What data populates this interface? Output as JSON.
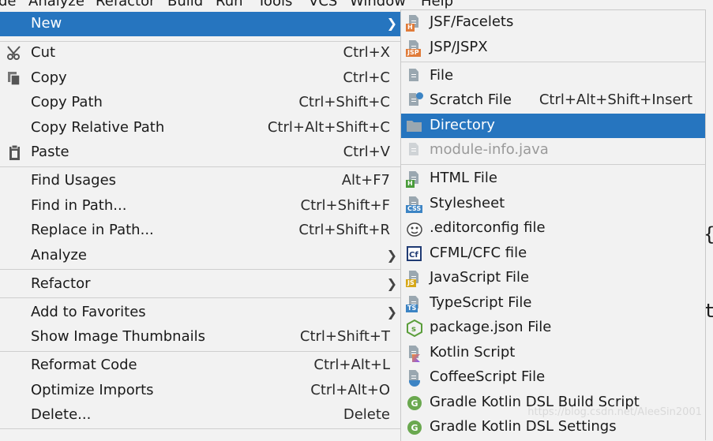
{
  "menubar": [
    "de",
    "Analyze",
    "Refactor",
    "Build",
    "Run",
    "Tools",
    "VCS",
    "Window",
    "Help"
  ],
  "editor": {
    "brace": "{",
    "t": "t"
  },
  "context_menu": {
    "items": [
      {
        "label": "New",
        "shortcut": "",
        "submenu": true,
        "selected": true
      },
      {
        "label": "Cut",
        "shortcut": "Ctrl+X",
        "icon": "scissors-icon"
      },
      {
        "label": "Copy",
        "shortcut": "Ctrl+C",
        "icon": "copy-icon"
      },
      {
        "label": "Copy Path",
        "shortcut": "Ctrl+Shift+C"
      },
      {
        "label": "Copy Relative Path",
        "shortcut": "Ctrl+Alt+Shift+C"
      },
      {
        "label": "Paste",
        "shortcut": "Ctrl+V",
        "icon": "paste-icon"
      },
      {
        "label": "Find Usages",
        "shortcut": "Alt+F7"
      },
      {
        "label": "Find in Path...",
        "shortcut": "Ctrl+Shift+F"
      },
      {
        "label": "Replace in Path...",
        "shortcut": "Ctrl+Shift+R"
      },
      {
        "label": "Analyze",
        "shortcut": "",
        "submenu": true
      },
      {
        "label": "Refactor",
        "shortcut": "",
        "submenu": true
      },
      {
        "label": "Add to Favorites",
        "shortcut": "",
        "submenu": true
      },
      {
        "label": "Show Image Thumbnails",
        "shortcut": "Ctrl+Shift+T"
      },
      {
        "label": "Reformat Code",
        "shortcut": "Ctrl+Alt+L"
      },
      {
        "label": "Optimize Imports",
        "shortcut": "Ctrl+Alt+O"
      },
      {
        "label": "Delete...",
        "shortcut": "Delete"
      }
    ]
  },
  "new_submenu": {
    "items": [
      {
        "label": "JSF/Facelets",
        "icon": "jsf-file-icon",
        "tag": "H",
        "tag_color": "#e07b39"
      },
      {
        "label": "JSP/JSPX",
        "icon": "jsp-file-icon",
        "tag": "JSP",
        "tag_color": "#e07b39"
      },
      {
        "label": "File",
        "icon": "file-icon"
      },
      {
        "label": "Scratch File",
        "shortcut": "Ctrl+Alt+Shift+Insert",
        "icon": "scratch-file-icon"
      },
      {
        "label": "Directory",
        "icon": "folder-icon",
        "selected": true
      },
      {
        "label": "module-info.java",
        "icon": "java-file-icon",
        "disabled": true
      },
      {
        "label": "HTML File",
        "icon": "html-file-icon",
        "tag": "H",
        "tag_color": "#4a9c3b"
      },
      {
        "label": "Stylesheet",
        "icon": "css-file-icon",
        "tag": "CSS",
        "tag_color": "#3c84c4"
      },
      {
        "label": ".editorconfig file",
        "icon": "editorconfig-icon"
      },
      {
        "label": "CFML/CFC file",
        "icon": "cfml-icon"
      },
      {
        "label": "JavaScript File",
        "icon": "js-file-icon",
        "tag": "JS",
        "tag_color": "#d6a718"
      },
      {
        "label": "TypeScript File",
        "icon": "ts-file-icon",
        "tag": "TS",
        "tag_color": "#3c84c4"
      },
      {
        "label": "package.json File",
        "icon": "nodejs-icon"
      },
      {
        "label": "Kotlin Script",
        "icon": "kotlin-file-icon"
      },
      {
        "label": "CoffeeScript File",
        "icon": "coffeescript-icon"
      },
      {
        "label": "Gradle Kotlin DSL Build Script",
        "icon": "gradle-icon"
      },
      {
        "label": "Gradle Kotlin DSL Settings",
        "icon": "gradle-icon"
      }
    ]
  },
  "watermark": "https://blog.csdn.net/AleeSin2001",
  "colors": {
    "selection": "#2675bf",
    "background": "#f2f2f2",
    "separator": "#cfcfcf"
  }
}
